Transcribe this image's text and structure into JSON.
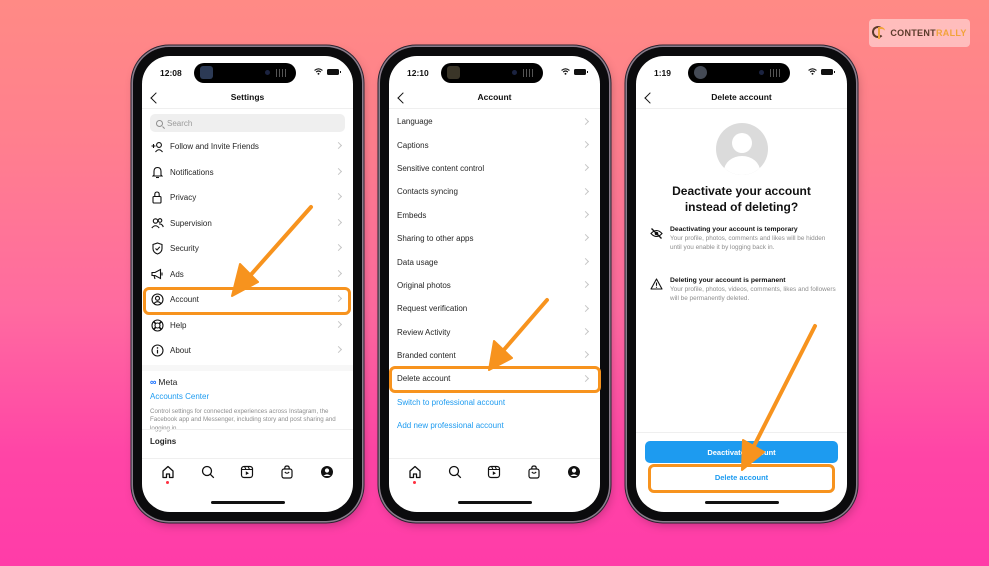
{
  "branding": {
    "logo_text_a": "CONTENT",
    "logo_text_b": "RALLY"
  },
  "colors": {
    "highlight": "#f7931e",
    "link": "#1d9bf0",
    "primary_button": "#1d9bf0"
  },
  "phones": [
    {
      "status": {
        "time": "12:08"
      },
      "nav_title": "Settings",
      "search_placeholder": "Search",
      "items": [
        {
          "label": "Follow and Invite Friends",
          "icon": "add-person-icon"
        },
        {
          "label": "Notifications",
          "icon": "bell-icon"
        },
        {
          "label": "Privacy",
          "icon": "lock-icon"
        },
        {
          "label": "Supervision",
          "icon": "people-icon"
        },
        {
          "label": "Security",
          "icon": "shield-check-icon"
        },
        {
          "label": "Ads",
          "icon": "megaphone-icon"
        },
        {
          "label": "Account",
          "icon": "user-circle-icon",
          "highlighted": true
        },
        {
          "label": "Help",
          "icon": "lifebuoy-icon"
        },
        {
          "label": "About",
          "icon": "info-icon"
        }
      ],
      "meta": {
        "brand": "Meta",
        "accounts_center": "Accounts Center",
        "description": "Control settings for connected experiences across Instagram, the Facebook app and Messenger, including story and post sharing and logging in."
      },
      "logins_label": "Logins"
    },
    {
      "status": {
        "time": "12:10"
      },
      "nav_title": "Account",
      "items": [
        {
          "label": "Language"
        },
        {
          "label": "Captions"
        },
        {
          "label": "Sensitive content control"
        },
        {
          "label": "Contacts syncing"
        },
        {
          "label": "Embeds"
        },
        {
          "label": "Sharing to other apps"
        },
        {
          "label": "Data usage"
        },
        {
          "label": "Original photos"
        },
        {
          "label": "Request verification"
        },
        {
          "label": "Review Activity"
        },
        {
          "label": "Branded content"
        },
        {
          "label": "Delete account",
          "highlighted": true
        }
      ],
      "links": [
        "Switch to professional account",
        "Add new professional account"
      ]
    },
    {
      "status": {
        "time": "1:19"
      },
      "nav_title": "Delete account",
      "headline_line1": "Deactivate your account",
      "headline_line2": "instead of deleting?",
      "info": [
        {
          "icon": "eye-off-icon",
          "title": "Deactivating your account is temporary",
          "desc": "Your profile, photos, comments and likes will be hidden until you enable it by logging back in."
        },
        {
          "icon": "warning-icon",
          "title": "Deleting your account is permanent",
          "desc": "Your profile, photos, videos, comments, likes and followers will be permanently deleted."
        }
      ],
      "deactivate_button": "Deactivate account",
      "delete_button": "Delete account"
    }
  ],
  "tabbar": [
    "home-icon",
    "search-icon",
    "reels-icon",
    "shop-icon",
    "profile-icon"
  ]
}
